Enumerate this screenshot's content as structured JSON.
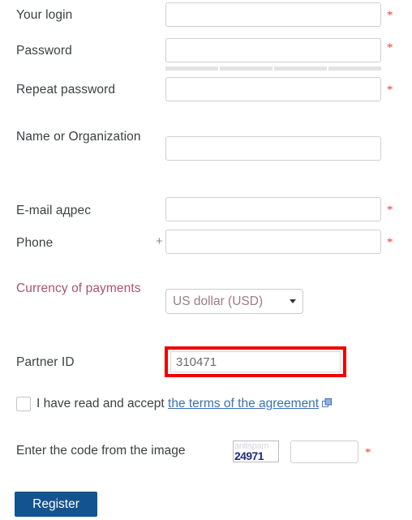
{
  "form": {
    "fields": [
      {
        "label": "Your login",
        "value": "",
        "placeholder": "",
        "required": true,
        "marker": "*"
      },
      {
        "label": "Password",
        "value": "",
        "placeholder": "",
        "required": true,
        "marker": "*"
      },
      {
        "label": "Repeat password",
        "value": "",
        "placeholder": "",
        "required": true,
        "marker": "*"
      },
      {
        "label": "Name or Organization",
        "value": "",
        "placeholder": "",
        "required": false,
        "marker": ""
      },
      {
        "label": "E-mail адрес",
        "value": "",
        "placeholder": "",
        "required": true,
        "marker": "*"
      },
      {
        "label": "Phone",
        "value": "",
        "placeholder": "",
        "required": true,
        "marker": "*",
        "prefix": "+"
      }
    ],
    "currency": {
      "label": "Currency of payments",
      "selected": "US dollar (USD)",
      "caret_icon": "chevron-down-icon"
    },
    "partner_id": {
      "label": "Partner ID",
      "value": "310471",
      "highlighted": true
    },
    "agreement": {
      "checked": false,
      "text": "I have read and accept",
      "link_text": "the terms of the agreement",
      "link_icon": "external-link-icon"
    },
    "captcha": {
      "label": "Enter the code from the image",
      "image_watermark": "antispam",
      "image_code": "24971",
      "input_value": "",
      "marker": "*"
    },
    "submit": {
      "label": "Register"
    }
  },
  "colors": {
    "required_marker": "#e8453c",
    "accent_label": "#a8556b",
    "link": "#3a6fb5",
    "highlight_border": "#ee0000",
    "submit_background": "#13538f",
    "captcha_code": "#1f2d7a"
  }
}
